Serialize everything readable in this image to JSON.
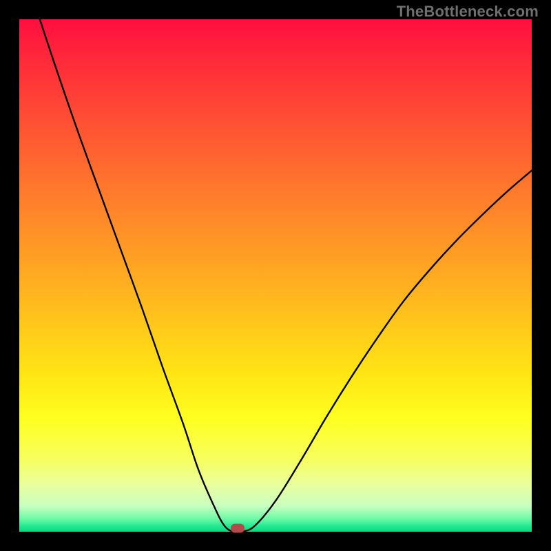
{
  "watermark": "TheBottleneck.com",
  "colors": {
    "frame": "#000000",
    "gradient_top": "#ff0f3f",
    "gradient_bottom": "#0fd780",
    "curve": "#000000",
    "marker": "#b14c4c",
    "watermark_text": "#6f6f6f"
  },
  "chart_data": {
    "type": "line",
    "title": "",
    "xlabel": "",
    "ylabel": "",
    "xlim": [
      0,
      100
    ],
    "ylim": [
      0,
      100
    ],
    "grid": false,
    "legend": false,
    "series": [
      {
        "name": "bottleneck-curve",
        "x": [
          4,
          8,
          12,
          16,
          20,
          24,
          28,
          32,
          35,
          38,
          40,
          41.8,
          43.5,
          46,
          50,
          55,
          60,
          65,
          70,
          75,
          80,
          85,
          90,
          95,
          100
        ],
        "y": [
          100,
          88,
          76.5,
          65.5,
          54.5,
          43.5,
          32,
          21,
          12,
          5,
          1.2,
          0,
          0,
          1.2,
          6,
          14,
          22.5,
          30.5,
          38,
          45,
          51,
          56.5,
          61.5,
          66.2,
          70.5
        ]
      }
    ],
    "marker": {
      "x": 42.6,
      "y": 0
    },
    "description": "V-shaped bottleneck curve on a vertical red-to-green gradient. Left branch descends steeply and nearly linearly from top-left to the valley; right branch rises with decreasing slope toward the right edge. A small rounded marker sits at the valley floor."
  }
}
